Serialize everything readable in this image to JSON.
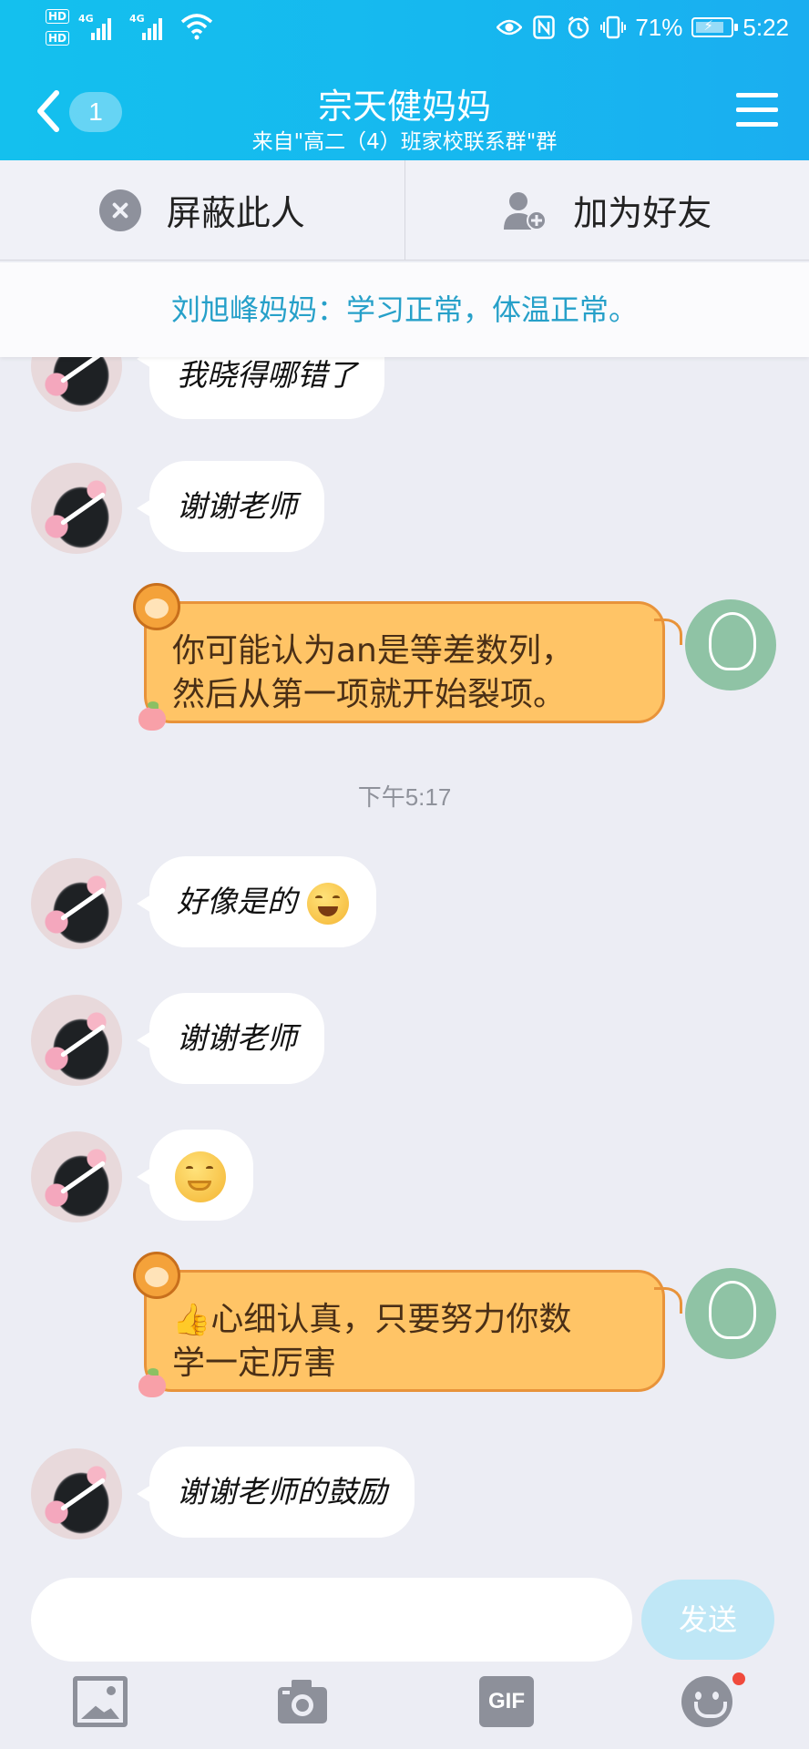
{
  "status_bar": {
    "hd1": "HD",
    "hd2": "HD",
    "net1": "4G",
    "net2": "4G",
    "battery": "71%",
    "time": "5:22"
  },
  "header": {
    "unread_count": "1",
    "title": "宗天健妈妈",
    "subtitle": "来自\"高二（4）班家校联系群\"群",
    "accent_color": "#16b8ef"
  },
  "actions": {
    "block_label": "屏蔽此人",
    "add_friend_label": "加为好友"
  },
  "notice": "刘旭峰妈妈：学习正常，体温正常。",
  "messages": {
    "m0": "我晓得哪错了",
    "m1": "谢谢老师",
    "m2_line1": "你可能认为an是等差数列，",
    "m2_line2": "然后从第一项就开始裂项。",
    "timestamp": "下午5:17",
    "m3": "好像是的",
    "m4": "谢谢老师",
    "m5_emoji": "face-with-hand-over-mouth-emoji",
    "m6_line1": "心细认真，只要努力你数",
    "m6_line2": "学一定厉害",
    "m7": "谢谢老师的鼓励"
  },
  "input": {
    "placeholder": "",
    "send_label": "发送"
  },
  "toolbar": {
    "gif_label": "GIF",
    "icons": [
      "image-icon",
      "camera-icon",
      "gif-icon",
      "emoji-icon"
    ]
  },
  "colors": {
    "outgoing_bubble": "#ffc466",
    "incoming_bubble": "#ffffff",
    "notice_text": "#26a0c9"
  }
}
